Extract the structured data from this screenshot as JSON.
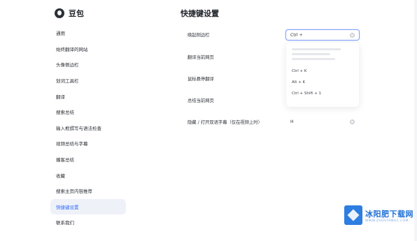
{
  "app": {
    "name": "豆包"
  },
  "sidebar": {
    "items": [
      {
        "label": "通用"
      },
      {
        "label": "始终翻译的网站"
      },
      {
        "label": "头像侧边栏"
      },
      {
        "label": "划词工具栏"
      },
      {
        "label": "翻译"
      },
      {
        "label": "搜索总结"
      },
      {
        "label": "输入框撰写与语法检查"
      },
      {
        "label": "视频总结与字幕"
      },
      {
        "label": "播客总结"
      },
      {
        "label": "收藏"
      },
      {
        "label": "搜索主页内容推荐"
      },
      {
        "label": "快捷键设置",
        "active": true
      },
      {
        "label": "联系我们"
      }
    ]
  },
  "main": {
    "title": "快捷键设置",
    "rows": [
      {
        "label": "唤起侧边栏",
        "value": "Ctrl + ",
        "focused": true
      },
      {
        "label": "翻译当前网页",
        "value": ""
      },
      {
        "label": "鼠标悬停翻译",
        "value": ""
      },
      {
        "label": "总结当前网页",
        "value": ""
      },
      {
        "label": "隐藏 / 打开双语字幕（仅在视频上时）",
        "value": "H"
      }
    ],
    "dropdown": {
      "options": [
        "Ctrl + K",
        "Alt + K",
        "Ctrl + Shift + 1"
      ]
    }
  },
  "watermark": {
    "title": "冰阳肥下载网",
    "subtitle": "WWW.ZHOUYANGC.COM"
  }
}
